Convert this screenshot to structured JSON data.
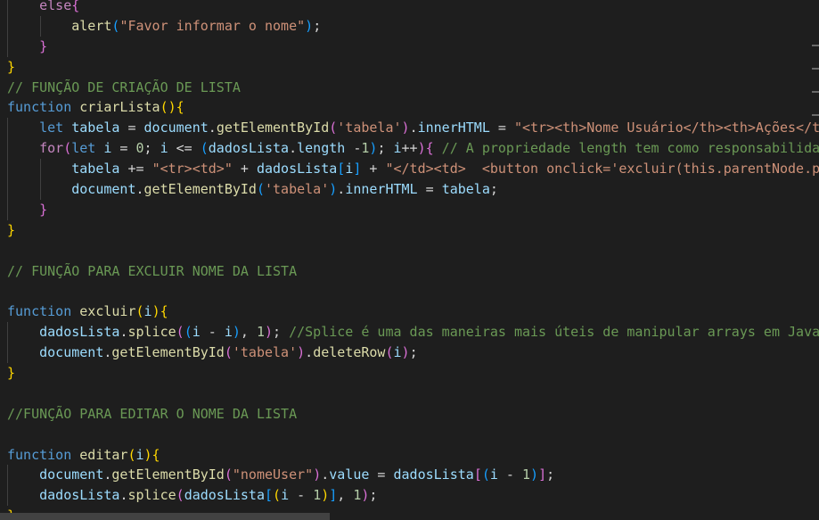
{
  "editor": {
    "language": "JavaScript",
    "colors": {
      "background": "#1e1e1e",
      "keyword": "#569cd6",
      "control": "#c586c0",
      "function": "#dcdcaa",
      "variable": "#9cdcfe",
      "string": "#ce9178",
      "number": "#b5cea8",
      "comment": "#6a9955"
    },
    "lines": [
      {
        "indent": 1,
        "tokens": [
          {
            "t": "    ",
            "c": "pun"
          },
          {
            "t": "else",
            "c": "ctl"
          },
          {
            "t": "{",
            "c": "b2"
          }
        ]
      },
      {
        "indent": 2,
        "tokens": [
          {
            "t": "        ",
            "c": "pun"
          },
          {
            "t": "alert",
            "c": "fn"
          },
          {
            "t": "(",
            "c": "b3"
          },
          {
            "t": "\"Favor informar o nome\"",
            "c": "str"
          },
          {
            "t": ")",
            "c": "b3"
          },
          {
            "t": ";",
            "c": "pun"
          }
        ]
      },
      {
        "indent": 1,
        "tokens": [
          {
            "t": "    ",
            "c": "pun"
          },
          {
            "t": "}",
            "c": "b2"
          }
        ]
      },
      {
        "indent": 0,
        "tokens": [
          {
            "t": "}",
            "c": "b1"
          }
        ]
      },
      {
        "indent": 0,
        "tokens": [
          {
            "t": "// FUNÇÃO DE CRIAÇÃO DE LISTA",
            "c": "com"
          }
        ]
      },
      {
        "indent": 0,
        "tokens": [
          {
            "t": "function",
            "c": "kw"
          },
          {
            "t": " ",
            "c": "pun"
          },
          {
            "t": "criarLista",
            "c": "fn"
          },
          {
            "t": "(){",
            "c": "b1"
          }
        ]
      },
      {
        "indent": 1,
        "tokens": [
          {
            "t": "    ",
            "c": "pun"
          },
          {
            "t": "let",
            "c": "kw"
          },
          {
            "t": " ",
            "c": "pun"
          },
          {
            "t": "tabela",
            "c": "var"
          },
          {
            "t": " = ",
            "c": "pun"
          },
          {
            "t": "document",
            "c": "var"
          },
          {
            "t": ".",
            "c": "pun"
          },
          {
            "t": "getElementById",
            "c": "fn"
          },
          {
            "t": "(",
            "c": "b2"
          },
          {
            "t": "'tabela'",
            "c": "str"
          },
          {
            "t": ")",
            "c": "b2"
          },
          {
            "t": ".",
            "c": "pun"
          },
          {
            "t": "innerHTML",
            "c": "var"
          },
          {
            "t": " = ",
            "c": "pun"
          },
          {
            "t": "\"<tr><th>Nome Usuário</th><th>Ações</th></tr>\"",
            "c": "str"
          }
        ]
      },
      {
        "indent": 1,
        "tokens": [
          {
            "t": "    ",
            "c": "pun"
          },
          {
            "t": "for",
            "c": "ctl"
          },
          {
            "t": "(",
            "c": "b2"
          },
          {
            "t": "let",
            "c": "kw"
          },
          {
            "t": " ",
            "c": "pun"
          },
          {
            "t": "i",
            "c": "var"
          },
          {
            "t": " = ",
            "c": "pun"
          },
          {
            "t": "0",
            "c": "num"
          },
          {
            "t": "; ",
            "c": "pun"
          },
          {
            "t": "i",
            "c": "var"
          },
          {
            "t": " <= ",
            "c": "pun"
          },
          {
            "t": "(",
            "c": "b3"
          },
          {
            "t": "dadosLista",
            "c": "var"
          },
          {
            "t": ".",
            "c": "pun"
          },
          {
            "t": "length",
            "c": "var"
          },
          {
            "t": " -",
            "c": "pun"
          },
          {
            "t": "1",
            "c": "num"
          },
          {
            "t": ")",
            "c": "b3"
          },
          {
            "t": "; ",
            "c": "pun"
          },
          {
            "t": "i",
            "c": "var"
          },
          {
            "t": "++",
            "c": "pun"
          },
          {
            "t": "){",
            "c": "b2"
          },
          {
            "t": " // A propriedade length tem como responsabilidade retornar a quantidade de elementos",
            "c": "com"
          }
        ]
      },
      {
        "indent": 2,
        "tokens": [
          {
            "t": "        ",
            "c": "pun"
          },
          {
            "t": "tabela",
            "c": "var"
          },
          {
            "t": " += ",
            "c": "pun"
          },
          {
            "t": "\"<tr><td>\"",
            "c": "str"
          },
          {
            "t": " + ",
            "c": "pun"
          },
          {
            "t": "dadosLista",
            "c": "var"
          },
          {
            "t": "[",
            "c": "b3"
          },
          {
            "t": "i",
            "c": "var"
          },
          {
            "t": "]",
            "c": "b3"
          },
          {
            "t": " + ",
            "c": "pun"
          },
          {
            "t": "\"</td><td>  <button onclick='excluir(this.parentNode.parentNode.rowIndex)'>",
            "c": "str"
          }
        ]
      },
      {
        "indent": 2,
        "tokens": [
          {
            "t": "        ",
            "c": "pun"
          },
          {
            "t": "document",
            "c": "var"
          },
          {
            "t": ".",
            "c": "pun"
          },
          {
            "t": "getElementById",
            "c": "fn"
          },
          {
            "t": "(",
            "c": "b3"
          },
          {
            "t": "'tabela'",
            "c": "str"
          },
          {
            "t": ")",
            "c": "b3"
          },
          {
            "t": ".",
            "c": "pun"
          },
          {
            "t": "innerHTML",
            "c": "var"
          },
          {
            "t": " = ",
            "c": "pun"
          },
          {
            "t": "tabela",
            "c": "var"
          },
          {
            "t": ";",
            "c": "pun"
          }
        ]
      },
      {
        "indent": 1,
        "tokens": [
          {
            "t": "    ",
            "c": "pun"
          },
          {
            "t": "}",
            "c": "b2"
          }
        ]
      },
      {
        "indent": 0,
        "tokens": [
          {
            "t": "}",
            "c": "b1"
          }
        ]
      },
      {
        "indent": 0,
        "tokens": []
      },
      {
        "indent": 0,
        "tokens": [
          {
            "t": "// FUNÇÃO PARA EXCLUIR NOME DA LISTA",
            "c": "com"
          }
        ]
      },
      {
        "indent": 0,
        "tokens": []
      },
      {
        "indent": 0,
        "tokens": [
          {
            "t": "function",
            "c": "kw"
          },
          {
            "t": " ",
            "c": "pun"
          },
          {
            "t": "excluir",
            "c": "fn"
          },
          {
            "t": "(",
            "c": "b1"
          },
          {
            "t": "i",
            "c": "var"
          },
          {
            "t": "){",
            "c": "b1"
          }
        ]
      },
      {
        "indent": 1,
        "tokens": [
          {
            "t": "    ",
            "c": "pun"
          },
          {
            "t": "dadosLista",
            "c": "var"
          },
          {
            "t": ".",
            "c": "pun"
          },
          {
            "t": "splice",
            "c": "fn"
          },
          {
            "t": "(",
            "c": "b2"
          },
          {
            "t": "(",
            "c": "b3"
          },
          {
            "t": "i",
            "c": "var"
          },
          {
            "t": " - ",
            "c": "pun"
          },
          {
            "t": "i",
            "c": "var"
          },
          {
            "t": ")",
            "c": "b3"
          },
          {
            "t": ", ",
            "c": "pun"
          },
          {
            "t": "1",
            "c": "num"
          },
          {
            "t": ")",
            "c": "b2"
          },
          {
            "t": "; ",
            "c": "pun"
          },
          {
            "t": "//Splice é uma das maneiras mais úteis de manipular arrays em JavaScript",
            "c": "com"
          }
        ]
      },
      {
        "indent": 1,
        "tokens": [
          {
            "t": "    ",
            "c": "pun"
          },
          {
            "t": "document",
            "c": "var"
          },
          {
            "t": ".",
            "c": "pun"
          },
          {
            "t": "getElementById",
            "c": "fn"
          },
          {
            "t": "(",
            "c": "b2"
          },
          {
            "t": "'tabela'",
            "c": "str"
          },
          {
            "t": ")",
            "c": "b2"
          },
          {
            "t": ".",
            "c": "pun"
          },
          {
            "t": "deleteRow",
            "c": "fn"
          },
          {
            "t": "(",
            "c": "b2"
          },
          {
            "t": "i",
            "c": "var"
          },
          {
            "t": ")",
            "c": "b2"
          },
          {
            "t": ";",
            "c": "pun"
          }
        ]
      },
      {
        "indent": 0,
        "tokens": [
          {
            "t": "}",
            "c": "b1"
          }
        ]
      },
      {
        "indent": 0,
        "tokens": []
      },
      {
        "indent": 0,
        "tokens": [
          {
            "t": "//FUNÇÃO PARA EDITAR O NOME DA LISTA",
            "c": "com"
          }
        ]
      },
      {
        "indent": 0,
        "tokens": []
      },
      {
        "indent": 0,
        "tokens": [
          {
            "t": "function",
            "c": "kw"
          },
          {
            "t": " ",
            "c": "pun"
          },
          {
            "t": "editar",
            "c": "fn"
          },
          {
            "t": "(",
            "c": "b1"
          },
          {
            "t": "i",
            "c": "var"
          },
          {
            "t": "){",
            "c": "b1"
          }
        ]
      },
      {
        "indent": 1,
        "tokens": [
          {
            "t": "    ",
            "c": "pun"
          },
          {
            "t": "document",
            "c": "var"
          },
          {
            "t": ".",
            "c": "pun"
          },
          {
            "t": "getElementById",
            "c": "fn"
          },
          {
            "t": "(",
            "c": "b2"
          },
          {
            "t": "\"nomeUser\"",
            "c": "str"
          },
          {
            "t": ")",
            "c": "b2"
          },
          {
            "t": ".",
            "c": "pun"
          },
          {
            "t": "value",
            "c": "var"
          },
          {
            "t": " = ",
            "c": "pun"
          },
          {
            "t": "dadosLista",
            "c": "var"
          },
          {
            "t": "[",
            "c": "b2"
          },
          {
            "t": "(",
            "c": "b3"
          },
          {
            "t": "i",
            "c": "var"
          },
          {
            "t": " - ",
            "c": "pun"
          },
          {
            "t": "1",
            "c": "num"
          },
          {
            "t": ")",
            "c": "b3"
          },
          {
            "t": "]",
            "c": "b2"
          },
          {
            "t": ";",
            "c": "pun"
          }
        ]
      },
      {
        "indent": 1,
        "tokens": [
          {
            "t": "    ",
            "c": "pun"
          },
          {
            "t": "dadosLista",
            "c": "var"
          },
          {
            "t": ".",
            "c": "pun"
          },
          {
            "t": "splice",
            "c": "fn"
          },
          {
            "t": "(",
            "c": "b2"
          },
          {
            "t": "dadosLista",
            "c": "var"
          },
          {
            "t": "[",
            "c": "b3"
          },
          {
            "t": "(",
            "c": "b1"
          },
          {
            "t": "i",
            "c": "var"
          },
          {
            "t": " - ",
            "c": "pun"
          },
          {
            "t": "1",
            "c": "num"
          },
          {
            "t": ")",
            "c": "b1"
          },
          {
            "t": "]",
            "c": "b3"
          },
          {
            "t": ", ",
            "c": "pun"
          },
          {
            "t": "1",
            "c": "num"
          },
          {
            "t": ")",
            "c": "b2"
          },
          {
            "t": ";",
            "c": "pun"
          }
        ]
      },
      {
        "indent": 0,
        "tokens": [
          {
            "t": "}",
            "c": "b1"
          }
        ]
      }
    ]
  }
}
